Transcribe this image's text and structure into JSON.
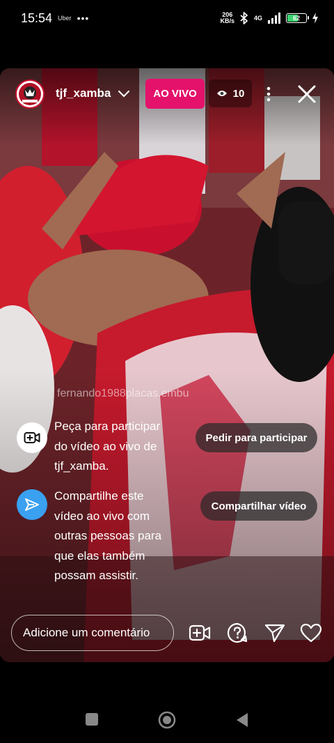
{
  "status_bar": {
    "time": "15:54",
    "app_label": "Uber",
    "dots": "•••",
    "net_speed_value": "206",
    "net_speed_unit": "KB/s",
    "network": "4G",
    "battery": "62",
    "icons": [
      "bluetooth-icon",
      "signal-icon",
      "battery-icon",
      "charging-icon"
    ]
  },
  "live": {
    "username": "tjf_xamba",
    "live_label": "AO VIVO",
    "viewer_count": "10",
    "watermark": "fernando1988placas.embu",
    "accent_color": "#e4126b"
  },
  "invite_join": {
    "text_lines": [
      "Peça para participar",
      "do vídeo ao vivo de",
      "tjf_xamba."
    ],
    "button_label": "Pedir para participar"
  },
  "invite_share": {
    "text_lines": [
      "Compartilhe este",
      "vídeo ao vivo com",
      "outras pessoas para",
      "que elas também",
      "possam assistir."
    ],
    "button_label": "Compartilhar vídeo",
    "icon_color": "#3aa0f0"
  },
  "comment": {
    "placeholder": "Adicione um comentário"
  },
  "actions": [
    "video-add-icon",
    "question-icon",
    "send-icon",
    "heart-icon"
  ],
  "nav": [
    "recents-icon",
    "home-icon",
    "back-icon"
  ]
}
